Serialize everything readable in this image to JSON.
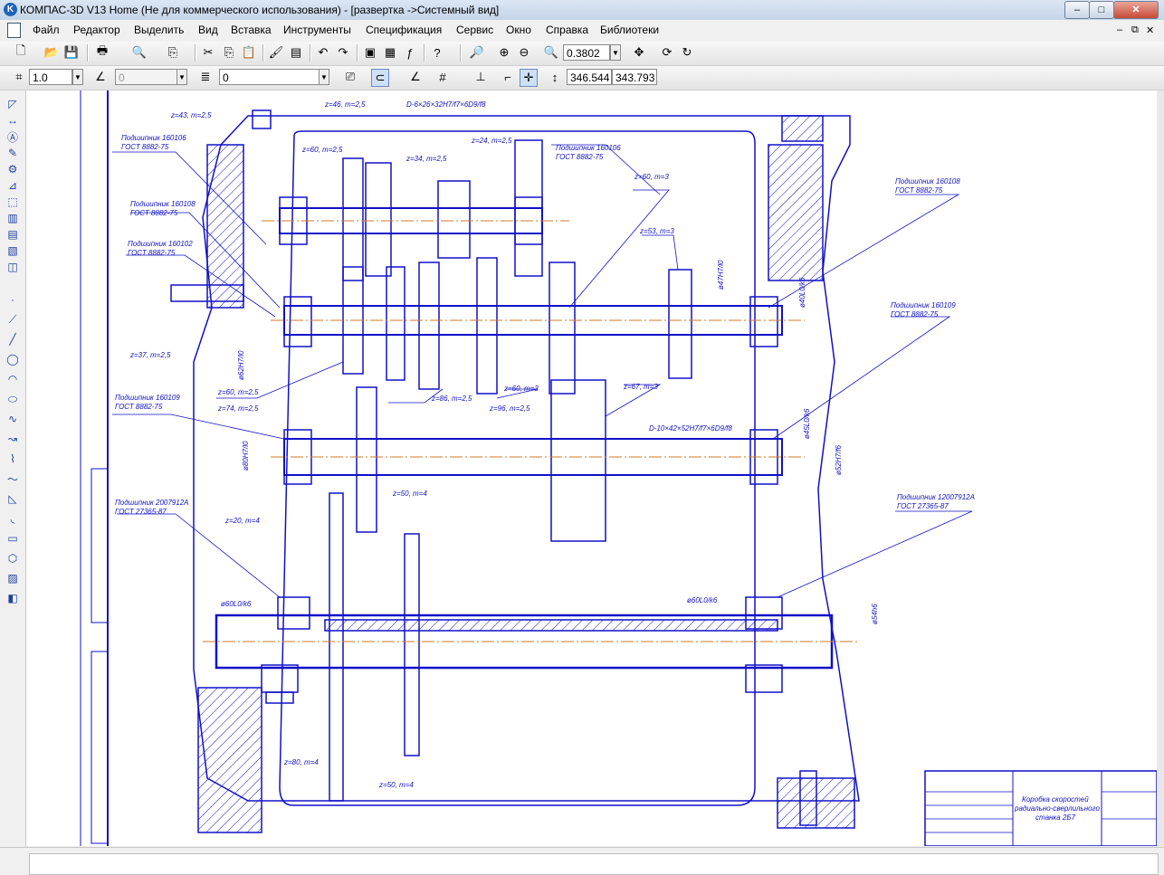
{
  "window": {
    "title": "КОМПАС-3D V13 Home (Не для коммерческого использования) - [развертка ->Системный вид]",
    "minimize": "–",
    "maximize": "□",
    "close": "✕"
  },
  "menu": {
    "items": [
      {
        "key": "file",
        "label": "Файл"
      },
      {
        "key": "edit",
        "label": "Редактор"
      },
      {
        "key": "select",
        "label": "Выделить"
      },
      {
        "key": "view",
        "label": "Вид"
      },
      {
        "key": "insert",
        "label": "Вставка"
      },
      {
        "key": "tools",
        "label": "Инструменты"
      },
      {
        "key": "spec",
        "label": "Спецификация"
      },
      {
        "key": "service",
        "label": "Сервис"
      },
      {
        "key": "window",
        "label": "Окно"
      },
      {
        "key": "help",
        "label": "Справка"
      },
      {
        "key": "libs",
        "label": "Библиотеки"
      }
    ],
    "doc_minimize": "–",
    "doc_restore": "⧉",
    "doc_close": "✕"
  },
  "toolbar_standard": {
    "zoom_value": "0.3802"
  },
  "toolbar_current_state": {
    "step_value": "1.0",
    "angle_value": "0",
    "layer_value": "0",
    "x_coord": "346.544",
    "y_coord": "343.793"
  },
  "drawing": {
    "annotations": [
      "z=43, m=2,5",
      "z=46, m=2,5",
      "D-6×26×32H7/f7×6D9/f8",
      "z=60, m=2,5",
      "z=34, m=2,5",
      "z=24, m=2,5",
      "Подшипник 160106",
      "ГОСТ 8882-75",
      "z=60, m=3",
      "Подшипник 160108",
      "Подшипник 160102",
      "z=53, m=3",
      "Подшипник 160109",
      "z=37, m=2,5",
      "z=60, m=2,5",
      "z=74, m=2,5",
      "z=86, m=2,5",
      "z=96, m=2,5",
      "z=60, m=3",
      "z=67, m=3",
      "D-10×42×52H7/f7×6D9/f8",
      "Подшипник 2007912А",
      "ГОСТ 27365-87",
      "z=20, m=4",
      "z=50, m=4",
      "Подшипник 12007912А",
      "ø60L0/k6",
      "ø60L0/k6",
      "ø54h6",
      "z=80, m=4",
      "z=50, m=4",
      "ø80H7/l0",
      "ø62H7/l0",
      "ø47H7/l0",
      "ø40L0/k6",
      "ø45L0/k6",
      "ø52H7/f6"
    ],
    "title_block": {
      "name_line1": "Коробка скоростей",
      "name_line2": "радиально-сверлильного",
      "name_line3": "станка 2Б7"
    }
  },
  "colors": {
    "drawing_line": "#1010c8",
    "axis_line": "#d07a20",
    "canvas": "#ffffff"
  }
}
